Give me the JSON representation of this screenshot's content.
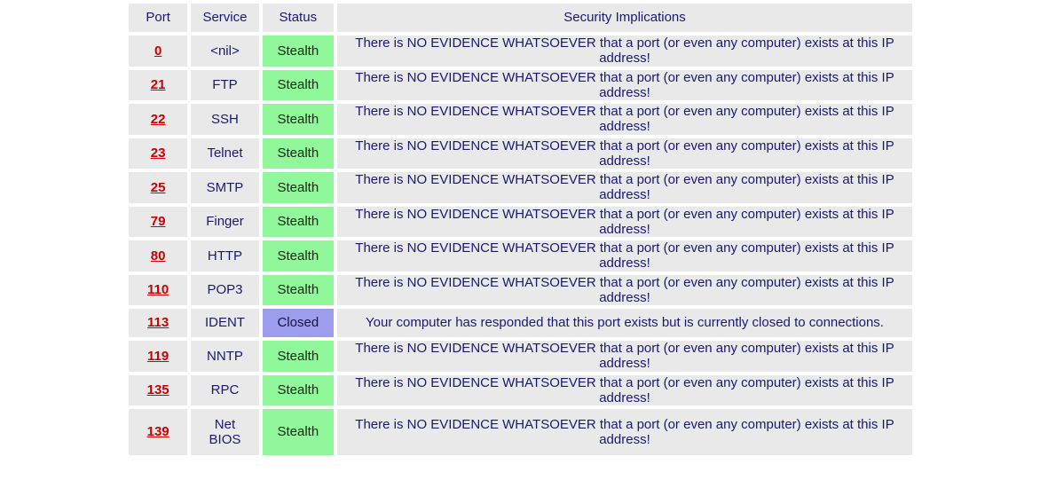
{
  "table": {
    "columns": [
      {
        "key": "port",
        "label": "Port"
      },
      {
        "key": "service",
        "label": "Service"
      },
      {
        "key": "status",
        "label": "Status"
      },
      {
        "key": "impl",
        "label": "Security Implications"
      }
    ],
    "messages": {
      "stealth": "There is NO EVIDENCE WHATSOEVER that a port (or even any computer) exists at this IP address!",
      "closed": "Your computer has responded that this port exists but is currently closed to connections."
    },
    "status_labels": {
      "stealth": "Stealth",
      "closed": "Closed"
    },
    "colors": {
      "cell_background": "#e9e9e9",
      "page_background": "#ffffff",
      "text": "#191970",
      "port_link": "#cc0000",
      "stealth_background": "#90f79a",
      "closed_background": "#9d9ded"
    },
    "rows": [
      {
        "port": "0",
        "service": "<nil>",
        "service_lines": [
          "<nil>"
        ],
        "status": "Stealth",
        "status_key": "stealth",
        "impl": "There is NO EVIDENCE WHATSOEVER that a port (or even any computer) exists at this IP address!"
      },
      {
        "port": "21",
        "service": "FTP",
        "service_lines": [
          "FTP"
        ],
        "status": "Stealth",
        "status_key": "stealth",
        "impl": "There is NO EVIDENCE WHATSOEVER that a port (or even any computer) exists at this IP address!"
      },
      {
        "port": "22",
        "service": "SSH",
        "service_lines": [
          "SSH"
        ],
        "status": "Stealth",
        "status_key": "stealth",
        "impl": "There is NO EVIDENCE WHATSOEVER that a port (or even any computer) exists at this IP address!"
      },
      {
        "port": "23",
        "service": "Telnet",
        "service_lines": [
          "Telnet"
        ],
        "status": "Stealth",
        "status_key": "stealth",
        "impl": "There is NO EVIDENCE WHATSOEVER that a port (or even any computer) exists at this IP address!"
      },
      {
        "port": "25",
        "service": "SMTP",
        "service_lines": [
          "SMTP"
        ],
        "status": "Stealth",
        "status_key": "stealth",
        "impl": "There is NO EVIDENCE WHATSOEVER that a port (or even any computer) exists at this IP address!"
      },
      {
        "port": "79",
        "service": "Finger",
        "service_lines": [
          "Finger"
        ],
        "status": "Stealth",
        "status_key": "stealth",
        "impl": "There is NO EVIDENCE WHATSOEVER that a port (or even any computer) exists at this IP address!"
      },
      {
        "port": "80",
        "service": "HTTP",
        "service_lines": [
          "HTTP"
        ],
        "status": "Stealth",
        "status_key": "stealth",
        "impl": "There is NO EVIDENCE WHATSOEVER that a port (or even any computer) exists at this IP address!"
      },
      {
        "port": "110",
        "service": "POP3",
        "service_lines": [
          "POP3"
        ],
        "status": "Stealth",
        "status_key": "stealth",
        "impl": "There is NO EVIDENCE WHATSOEVER that a port (or even any computer) exists at this IP address!"
      },
      {
        "port": "113",
        "service": "IDENT",
        "service_lines": [
          "IDENT"
        ],
        "status": "Closed",
        "status_key": "closed",
        "impl": "Your computer has responded that this port exists but is currently closed to connections."
      },
      {
        "port": "119",
        "service": "NNTP",
        "service_lines": [
          "NNTP"
        ],
        "status": "Stealth",
        "status_key": "stealth",
        "impl": "There is NO EVIDENCE WHATSOEVER that a port (or even any computer) exists at this IP address!"
      },
      {
        "port": "135",
        "service": "RPC",
        "service_lines": [
          "RPC"
        ],
        "status": "Stealth",
        "status_key": "stealth",
        "impl": "There is NO EVIDENCE WHATSOEVER that a port (or even any computer) exists at this IP address!"
      },
      {
        "port": "139",
        "service": "NetBIOS",
        "service_lines": [
          "Net",
          "BIOS"
        ],
        "status": "Stealth",
        "status_key": "stealth",
        "impl": "There is NO EVIDENCE WHATSOEVER that a port (or even any computer) exists at this IP address!"
      }
    ]
  }
}
